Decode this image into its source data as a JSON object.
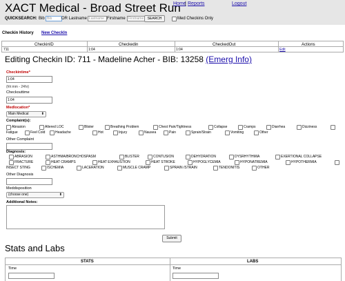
{
  "header": {
    "title": "XACT Medical - Broad Street Run",
    "nav": {
      "home": "Home",
      "separator": "|",
      "reports": "Reports",
      "logout": "Logout"
    },
    "quicksearch": {
      "label": "QUICKSEARCH:",
      "bib_label": "Bib",
      "bib_placeholder": "Bib",
      "or_lastname_label": "OR Lastname",
      "lastname_placeholder": "Lastname",
      "firstname_label": "Firstname",
      "firstname_placeholder": "Firstname",
      "search_button": "SEARCH",
      "med_checkins_label": "Med Checkins Only"
    }
  },
  "history": {
    "title": "Checkin History",
    "new_checkin": "New CheckIn",
    "columns": [
      "CheckinID",
      "Checkedin",
      "CheckedOut",
      "Actions"
    ],
    "rows": [
      {
        "id": "711",
        "checkedin": "1:04",
        "checkedout": "1:04",
        "action": "Edit"
      }
    ]
  },
  "edit": {
    "title": "Editing Checkin ID: 711 - Madeline Acher - BIB: 13258",
    "emerg_link": "(Emerg Info)",
    "checkintime_label": "Checkintime",
    "checkintime_value": "1:04",
    "time_hint": "(hh:mm - 24hr)",
    "checkouttime_label": "Checkouttime",
    "checkouttime_value": "1:04",
    "medlocation_label": "Medlocation",
    "medlocation_value": "Main Medical",
    "complaints_label": "Complaint(s):",
    "complaints_row1": [
      "Abrasion",
      "Altered LOC",
      "Blister",
      "Breathing Problem",
      "Chest Pain/Tightness",
      "Collapse",
      "Cramps",
      "Diarrhea",
      "Dizziness"
    ],
    "complaints_row2": [
      "Fatigue",
      "Feel Cold",
      "Headache",
      "Hot",
      "Injury",
      "Nausea",
      "Pain",
      "Sprain/Strain",
      "Vomiting",
      "Other"
    ],
    "other_complaint_label": "Other Complaint",
    "diagnosis_label": "Diagnosis:",
    "diagnosis_row1": [
      "ABRASION",
      "ASTHMA/BRONCHOSPASM",
      "BLISTER",
      "CONTUSION",
      "DEHYDRATION",
      "DYSRHYTHMIA",
      "EXERTIONAL COLLAPSE"
    ],
    "diagnosis_row2": [
      "FRACTURE",
      "HEAT CRAMPS",
      "HEAT EXHAUSTION",
      "HEAT STROKE",
      "HYPOGLYCEMIA",
      "HYPONATREMIA",
      "HYPOTHERMIA"
    ],
    "diagnosis_row3": [
      "INSECT STING",
      "ISCHEMIA",
      "LACERATION",
      "MUSCLE CRAMP",
      "SPRAIN /STRAIN",
      "TENDONITIS",
      "OTHER"
    ],
    "other_diagnosis_label": "Other Diagnosis",
    "meddisposition_label": "Meddisposition",
    "meddisposition_value": "(choose one)",
    "notes_label": "Additional Notes:",
    "submit": "Submit"
  },
  "stats": {
    "title": "Stats and Labs",
    "stats_header": "STATS",
    "labs_header": "LABS",
    "stats_time_label": "Time",
    "labs_time_label": "Time"
  }
}
